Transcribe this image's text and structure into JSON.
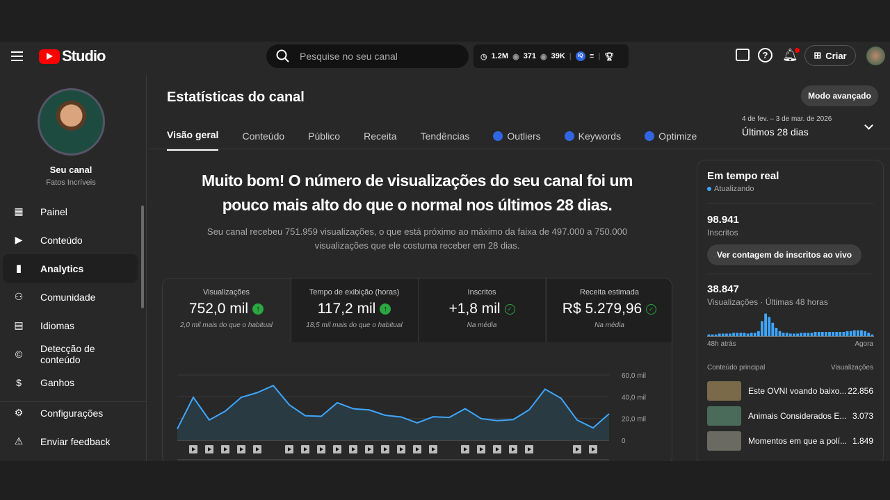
{
  "header": {
    "logo": "Studio",
    "search_placeholder": "Pesquise no seu canal",
    "stats": {
      "watch": "1.2M",
      "views1": "371",
      "views2": "39K"
    },
    "create": "Criar"
  },
  "channel": {
    "name": "Seu canal",
    "subtitle": "Fatos Incríveis"
  },
  "sidebar": {
    "items": [
      {
        "label": "Painel",
        "icon": "dashboard-icon"
      },
      {
        "label": "Conteúdo",
        "icon": "content-icon"
      },
      {
        "label": "Analytics",
        "icon": "analytics-icon",
        "active": true
      },
      {
        "label": "Comunidade",
        "icon": "community-icon"
      },
      {
        "label": "Idiomas",
        "icon": "subtitles-icon"
      },
      {
        "label": "Detecção de conteúdo",
        "icon": "copyright-icon"
      },
      {
        "label": "Ganhos",
        "icon": "earn-icon"
      }
    ],
    "settings": "Configurações",
    "feedback": "Enviar feedback"
  },
  "page": {
    "title": "Estatísticas do canal",
    "advanced": "Modo avançado",
    "date_range": "4 de fev. – 3 de mar. de 2026",
    "period": "Últimos 28 dias",
    "tabs": [
      "Visão geral",
      "Conteúdo",
      "Público",
      "Receita",
      "Tendências",
      "Outliers",
      "Keywords",
      "Optimize"
    ],
    "headline": "Muito bom! O número de visualizações do seu canal foi um pouco mais alto do que o normal nos últimos 28 dias.",
    "subtext": "Seu canal recebeu 751.959 visualizações, o que está próximo ao máximo da faixa de 497.000 a 750.000 visualizações que ele costuma receber em 28 dias."
  },
  "metrics": [
    {
      "label": "Visualizações",
      "value": "752,0 mil",
      "sub": "2,0 mil mais do que o habitual",
      "status": "up"
    },
    {
      "label": "Tempo de exibição (horas)",
      "value": "117,2 mil",
      "sub": "18,5 mil mais do que o habitual",
      "status": "up"
    },
    {
      "label": "Inscritos",
      "value": "+1,8 mil",
      "sub": "Na média",
      "status": "ok"
    },
    {
      "label": "Receita estimada",
      "value": "R$ 5.279,96",
      "sub": "Na média",
      "status": "ok"
    }
  ],
  "chart_data": {
    "type": "area",
    "title": "Visualizações",
    "ylim": [
      0,
      60
    ],
    "yticks": [
      "60,0 mil",
      "40,0 mil",
      "20,0 mil",
      "0"
    ],
    "yvalues": [
      60,
      40,
      20,
      0
    ],
    "values": [
      10.5,
      39.5,
      18.6,
      26.8,
      39.5,
      43.8,
      50.3,
      32.6,
      22.6,
      22,
      34.5,
      29,
      27.9,
      23,
      21.4,
      16,
      21.6,
      21,
      29,
      19.9,
      18,
      19,
      28,
      47,
      38.5,
      18.6,
      11.4,
      24.3
    ],
    "video_markers": [
      1,
      2,
      3,
      4,
      5,
      7,
      8,
      9,
      10,
      11,
      12,
      13,
      14,
      15,
      16,
      18,
      19,
      20,
      21,
      22,
      25,
      26
    ]
  },
  "realtime": {
    "title": "Em tempo real",
    "status": "Atualizando",
    "subs": "98.941",
    "subs_label": "Inscritos",
    "live_btn": "Ver contagem de inscritos ao vivo",
    "views": "38.847",
    "views_label": "Visualizações · Últimas 48 horas",
    "start": "48h atrás",
    "end": "Agora",
    "bars": [
      2,
      2,
      2,
      3,
      3,
      3,
      3,
      4,
      4,
      4,
      4,
      3,
      4,
      4,
      6,
      18,
      27,
      23,
      16,
      10,
      6,
      4,
      4,
      3,
      3,
      3,
      4,
      4,
      4,
      4,
      5,
      5,
      5,
      5,
      5,
      5,
      5,
      5,
      5,
      6,
      6,
      7,
      7,
      7,
      6,
      4,
      2
    ],
    "content_header": "Conteúdo principal",
    "views_header": "Visualizações",
    "videos": [
      {
        "title": "Este OVNI voando baixo...",
        "views": "22.856"
      },
      {
        "title": "Animais Considerados E...",
        "views": "3.073"
      },
      {
        "title": "Momentos em que a polí...",
        "views": "1.849"
      }
    ]
  },
  "colors": {
    "accent": "#3ea6ff",
    "green": "#2ba640",
    "brand": "#ff0000"
  }
}
